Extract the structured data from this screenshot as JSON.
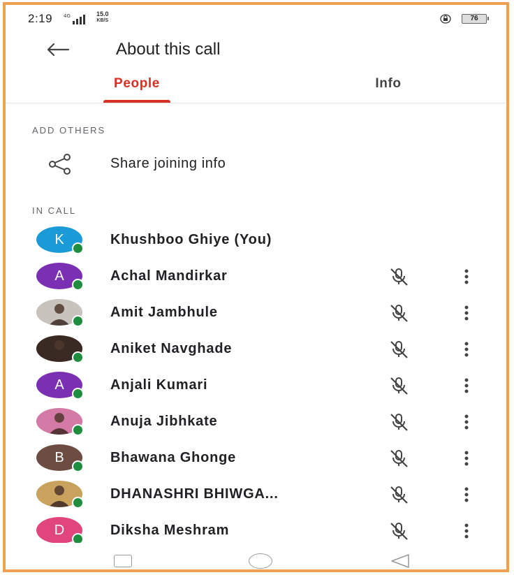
{
  "status": {
    "time": "2:19",
    "network": "4G",
    "speed_value": "15.0",
    "speed_unit": "KB/S",
    "battery": "76"
  },
  "header": {
    "title": "About this call"
  },
  "tabs": [
    {
      "label": "People",
      "active": true
    },
    {
      "label": "Info",
      "active": false
    }
  ],
  "add_others": {
    "heading": "ADD OTHERS",
    "share_label": "Share joining info",
    "icon": "share-icon"
  },
  "in_call": {
    "heading": "IN CALL",
    "participants": [
      {
        "name": "Khushboo Ghiye (You)",
        "initial": "K",
        "color": "#1a9ad6",
        "muted_icon": false,
        "more": false
      },
      {
        "name": "Achal Mandirkar",
        "initial": "A",
        "color": "#7b2fb3",
        "muted_icon": true,
        "more": true
      },
      {
        "name": "Amit Jambhule",
        "initial": "",
        "color": "#c8c4bd",
        "photo": true,
        "muted_icon": true,
        "more": true
      },
      {
        "name": "Aniket Navghade",
        "initial": "",
        "color": "#3a2a24",
        "photo": true,
        "muted_icon": true,
        "more": true
      },
      {
        "name": "Anjali Kumari",
        "initial": "A",
        "color": "#7b2fb3",
        "muted_icon": true,
        "more": true
      },
      {
        "name": "Anuja Jibhkate",
        "initial": "",
        "color": "#d37aa6",
        "photo": true,
        "muted_icon": true,
        "more": true
      },
      {
        "name": "Bhawana Ghonge",
        "initial": "B",
        "color": "#6d4c41",
        "muted_icon": true,
        "more": true
      },
      {
        "name": "DHANASHRI BHIWGA...",
        "initial": "",
        "color": "#c9a35e",
        "photo": true,
        "muted_icon": true,
        "more": true
      },
      {
        "name": "Diksha Meshram",
        "initial": "D",
        "color": "#e0467c",
        "muted_icon": true,
        "more": true
      }
    ]
  },
  "colors": {
    "accent": "#d93025",
    "online": "#1e8e3e",
    "frame": "#f0a052"
  }
}
